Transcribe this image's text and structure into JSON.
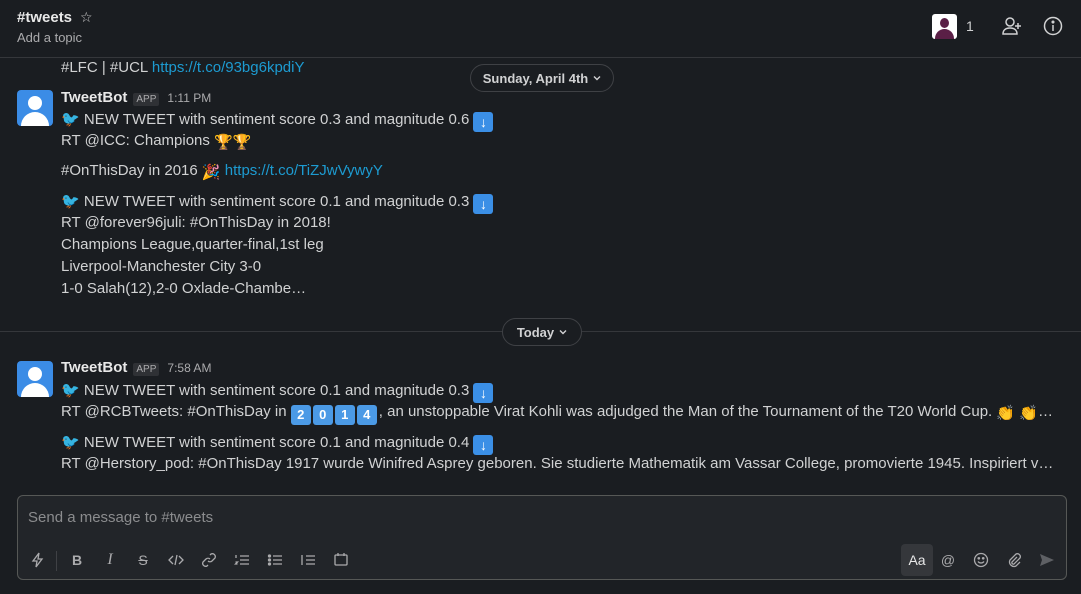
{
  "header": {
    "channel": "#tweets",
    "topic": "Add a topic",
    "member_count": "1"
  },
  "messages": {
    "cont_line": {
      "text": "#LFC | #UCL ",
      "link": "https://t.co/93bg6kpdiY"
    },
    "date1": "Sunday, April 4th",
    "date2": "Today",
    "group1": {
      "author": "TweetBot",
      "badge": "APP",
      "time": "1:11 PM",
      "m1_l1": "NEW TWEET with sentiment score 0.3 and magnitude 0.6",
      "m1_l2": "RT @ICC: Champions",
      "m1_l3": "#OnThisDay in 2016",
      "m1_l3_link": "https://t.co/TiZJwVywyY",
      "m2_l1": "NEW TWEET with sentiment score 0.1 and magnitude 0.3",
      "m2_l2": "RT @forever96juli: #OnThisDay in 2018!",
      "m2_l3": "Champions League,quarter-final,1st leg",
      "m2_l4": "Liverpool-Manchester City 3-0",
      "m2_l5": "1-0 Salah(12),2-0 Oxlade-Chambe…"
    },
    "group2": {
      "author": "TweetBot",
      "badge": "APP",
      "time": "7:58 AM",
      "m1_l1": "NEW TWEET with sentiment score 0.1 and magnitude 0.3",
      "m1_l2_a": "RT @RCBTweets: #OnThisDay in",
      "keycaps": [
        "2",
        "0",
        "1",
        "4"
      ],
      "m1_l2_b": ", an unstoppable Virat Kohli was adjudged the Man of the Tournament of the T20 World Cup.",
      "m1_l2_end": "…",
      "m2_l1": "NEW TWEET with sentiment score 0.1 and magnitude 0.4",
      "m2_l2": "RT @Herstory_pod: #OnThisDay 1917 wurde Winifred Asprey geboren. Sie studierte Mathematik am Vassar College, promovierte 1945. Inspiriert v…"
    }
  },
  "composer": {
    "placeholder": "Send a message to #tweets",
    "format_label": "Aa"
  },
  "icons": {
    "bird": "bird-icon",
    "arrow": "down-arrow-icon",
    "trophy": "trophy-icon",
    "party": "party-popper-icon",
    "clap": "clapping-hands-icon"
  },
  "colors": {
    "background": "#1a1d21",
    "link": "#1d9bd1",
    "avatar": "#3b8ce6",
    "text": "#d1d2d3"
  }
}
